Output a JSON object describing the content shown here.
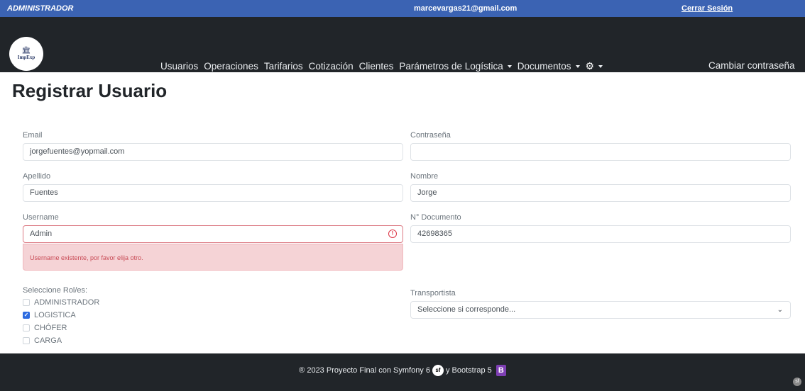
{
  "topbar": {
    "role": "ADMINISTRADOR",
    "email": "marcevargas21@gmail.com",
    "logout": "Cerrar Sesión"
  },
  "navbar": {
    "logo_text": "ImpExp",
    "links": [
      "Usuarios",
      "Operaciones",
      "Tarifarios",
      "Cotización",
      "Clientes"
    ],
    "dropdowns": [
      "Parámetros de Logística",
      "Documentos"
    ],
    "settings_icon": "gear-icon",
    "change_password": "Cambiar contraseña"
  },
  "page": {
    "title": "Registrar Usuario"
  },
  "form": {
    "email": {
      "label": "Email",
      "value": "jorgefuentes@yopmail.com"
    },
    "password": {
      "label": "Contraseña",
      "value": ""
    },
    "lastname": {
      "label": "Apellido",
      "value": "Fuentes"
    },
    "firstname": {
      "label": "Nombre",
      "value": "Jorge"
    },
    "username": {
      "label": "Username",
      "value": "Admin",
      "error": "Username existente, por favor elija otro."
    },
    "document": {
      "label": "N° Documento",
      "value": "42698365"
    },
    "roles": {
      "label": "Seleccione Rol/es:",
      "options": [
        {
          "label": "ADMINISTRADOR",
          "checked": false
        },
        {
          "label": "LOGISTICA",
          "checked": true
        },
        {
          "label": "CHÓFER",
          "checked": false
        },
        {
          "label": "CARGA",
          "checked": false
        }
      ]
    },
    "carrier": {
      "label": "Transportista",
      "value": "Seleccione si corresponde..."
    }
  },
  "footer": {
    "text_prefix": "® 2023 Proyecto Final con Symfony 6",
    "text_middle": "y Bootstrap 5",
    "symfony_logo": "sf",
    "bootstrap_logo": "B"
  },
  "colors": {
    "topbar": "#3b63b3",
    "navbar": "#212529",
    "error": "#dc3545",
    "checkbox": "#2d6be0"
  }
}
